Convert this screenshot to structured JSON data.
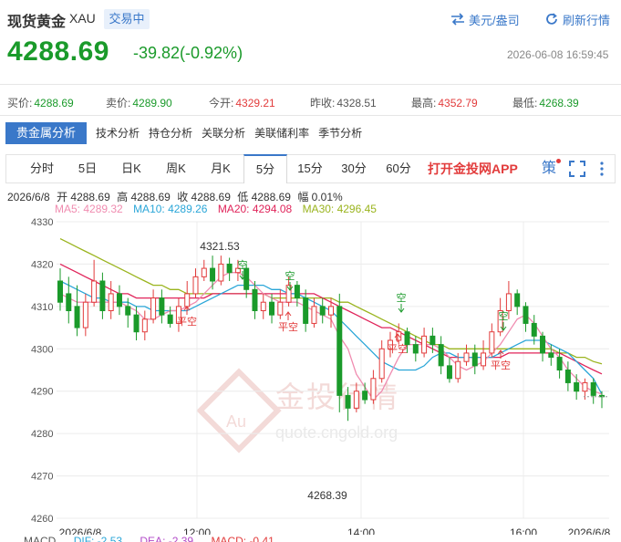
{
  "header": {
    "title": "现货黄金",
    "code": "XAU",
    "status": "交易中",
    "currency_label": "美元/盎司",
    "refresh_label": "刷新行情"
  },
  "price": {
    "last": "4288.69",
    "change": "-39.82(-0.92%)",
    "datetime": "2026-06-08 16:59:45"
  },
  "quotes": [
    {
      "label": "买价:",
      "value": "4288.69",
      "color": "green"
    },
    {
      "label": "卖价:",
      "value": "4289.90",
      "color": "green"
    },
    {
      "label": "今开:",
      "value": "4329.21",
      "color": "red"
    },
    {
      "label": "昨收:",
      "value": "4328.51",
      "color": "plain"
    },
    {
      "label": "最高:",
      "value": "4352.79",
      "color": "red"
    },
    {
      "label": "最低:",
      "value": "4268.39",
      "color": "green"
    }
  ],
  "tabs": [
    "贵金属分析",
    "技术分析",
    "持仓分析",
    "关联分析",
    "美联储利率",
    "季节分析"
  ],
  "periods": [
    "分时",
    "5日",
    "日K",
    "周K",
    "月K",
    "5分",
    "15分",
    "30分",
    "60分"
  ],
  "active_period": "5分",
  "toolbar": {
    "app_link": "打开金投网APP",
    "strategy": "策",
    "fullscreen_icon": "fullscreen-icon",
    "more_icon": "more-vertical-icon"
  },
  "bar_info": {
    "date": "2026/6/8",
    "open": "开 4288.69",
    "high": "高 4288.69",
    "close": "收 4288.69",
    "low": "低 4288.69",
    "amplitude": "幅 0.01%"
  },
  "ma_legend": [
    {
      "label": "MA5: 4289.32",
      "color": "#f08cb0"
    },
    {
      "label": "MA10: 4289.26",
      "color": "#2aa6d8"
    },
    {
      "label": "MA20: 4294.08",
      "color": "#e0245a"
    },
    {
      "label": "MA30: 4296.45",
      "color": "#9ab41e"
    }
  ],
  "macd_row": [
    {
      "label": "MACD",
      "color": "#555"
    },
    {
      "label": "DIF: -2.53",
      "color": "#2aa6d8"
    },
    {
      "label": "DEA: -2.39",
      "color": "#b24ac8"
    },
    {
      "label": "MACD: -0.41",
      "color": "#e23b3b"
    }
  ],
  "watermark": {
    "brand": "金投行情",
    "url": "quote.cngold.org",
    "logo": "Au"
  },
  "colors": {
    "up": "#e23b3b",
    "down": "#1a9a2a",
    "accent": "#3a78c9"
  },
  "chart_data": {
    "type": "candlestick",
    "ylim": [
      4260,
      4330
    ],
    "yticks": [
      4330,
      4320,
      4310,
      4300,
      4290,
      4280,
      4270,
      4260
    ],
    "xticks": [
      "2026/6/8",
      "12:00",
      "14:00",
      "16:00",
      "2026/6/8"
    ],
    "annotations": [
      {
        "text": "4321.53",
        "kind": "high"
      },
      {
        "text": "4268.39",
        "kind": "low"
      }
    ],
    "signals": [
      "平空",
      "空",
      "平空",
      "空",
      "平空",
      "空",
      "平空"
    ],
    "candles": [
      [
        4316,
        4311,
        4319,
        4309
      ],
      [
        4313,
        4309,
        4317,
        4306
      ],
      [
        4310,
        4305,
        4315,
        4303
      ],
      [
        4305,
        4311,
        4313,
        4303
      ],
      [
        4311,
        4316,
        4321,
        4310
      ],
      [
        4316,
        4309,
        4318,
        4307
      ],
      [
        4309,
        4313,
        4316,
        4307
      ],
      [
        4313,
        4310,
        4315,
        4308
      ],
      [
        4310,
        4308,
        4312,
        4305
      ],
      [
        4308,
        4304,
        4310,
        4302
      ],
      [
        4304,
        4307,
        4309,
        4302
      ],
      [
        4307,
        4312,
        4314,
        4306
      ],
      [
        4312,
        4308,
        4314,
        4306
      ],
      [
        4308,
        4306,
        4310,
        4305
      ],
      [
        4306,
        4310,
        4312,
        4304
      ],
      [
        4310,
        4313,
        4316,
        4309
      ],
      [
        4313,
        4317,
        4319,
        4312
      ],
      [
        4317,
        4319,
        4321,
        4316
      ],
      [
        4319,
        4316,
        4322,
        4314
      ],
      [
        4316,
        4320,
        4322,
        4315
      ],
      [
        4320,
        4318,
        4321.5,
        4316
      ],
      [
        4318,
        4319,
        4321,
        4316
      ],
      [
        4319,
        4314,
        4320,
        4312
      ],
      [
        4314,
        4309,
        4316,
        4307
      ],
      [
        4309,
        4311,
        4313,
        4307
      ],
      [
        4311,
        4308,
        4313,
        4306
      ],
      [
        4308,
        4311,
        4314,
        4307
      ],
      [
        4311,
        4315,
        4317,
        4310
      ],
      [
        4315,
        4312,
        4316,
        4310
      ],
      [
        4312,
        4306,
        4314,
        4304
      ],
      [
        4306,
        4310,
        4312,
        4305
      ],
      [
        4310,
        4308,
        4312,
        4306
      ],
      [
        4308,
        4310,
        4312,
        4305
      ],
      [
        4310,
        4289,
        4313,
        4285
      ],
      [
        4289,
        4286,
        4291,
        4283
      ],
      [
        4286,
        4290,
        4292,
        4285
      ],
      [
        4290,
        4288,
        4292,
        4287
      ],
      [
        4288,
        4293,
        4295,
        4287
      ],
      [
        4293,
        4300,
        4302,
        4292
      ],
      [
        4300,
        4302,
        4304,
        4298
      ],
      [
        4302,
        4304,
        4306,
        4301
      ],
      [
        4304,
        4301,
        4305,
        4299
      ],
      [
        4301,
        4299,
        4303,
        4297
      ],
      [
        4299,
        4303,
        4305,
        4298
      ],
      [
        4303,
        4301,
        4305,
        4299
      ],
      [
        4301,
        4296,
        4303,
        4294
      ],
      [
        4296,
        4293,
        4298,
        4292
      ],
      [
        4293,
        4297,
        4299,
        4292
      ],
      [
        4297,
        4299,
        4301,
        4296
      ],
      [
        4299,
        4296,
        4301,
        4294
      ],
      [
        4296,
        4299,
        4302,
        4295
      ],
      [
        4299,
        4304,
        4306,
        4298
      ],
      [
        4304,
        4309,
        4312,
        4303
      ],
      [
        4309,
        4313,
        4316,
        4307
      ],
      [
        4313,
        4310,
        4314,
        4308
      ],
      [
        4310,
        4306,
        4311,
        4304
      ],
      [
        4306,
        4303,
        4308,
        4301
      ],
      [
        4303,
        4299,
        4304,
        4297
      ],
      [
        4299,
        4298,
        4301,
        4296
      ],
      [
        4298,
        4295,
        4300,
        4293
      ],
      [
        4295,
        4292,
        4297,
        4290
      ],
      [
        4292,
        4290,
        4294,
        4288
      ],
      [
        4290,
        4292,
        4293,
        4288
      ],
      [
        4292,
        4289,
        4293,
        4287
      ],
      [
        4289,
        4288.69,
        4290,
        4286
      ]
    ],
    "candles_note": "open, close, high, low per 5-minute bar",
    "ma5": [
      4313,
      4312,
      4311,
      4311,
      4311,
      4311,
      4311,
      4311,
      4310,
      4309,
      4307,
      4307,
      4308,
      4309,
      4309,
      4310,
      4311,
      4313,
      4315,
      4317,
      4318,
      4318,
      4317,
      4315,
      4313,
      4312,
      4311,
      4311,
      4311,
      4310,
      4309,
      4308,
      4307,
      4303,
      4300,
      4294,
      4291,
      4288,
      4290,
      4294,
      4298,
      4301,
      4301,
      4301,
      4301,
      4300,
      4298,
      4296,
      4295,
      4296,
      4297,
      4299,
      4301,
      4304,
      4307,
      4308,
      4306,
      4303,
      4300,
      4298,
      4295,
      4293,
      4291,
      4290,
      4289.32
    ],
    "ma10": [
      4316,
      4315,
      4314,
      4313,
      4312,
      4312,
      4311,
      4311,
      4311,
      4310,
      4310,
      4309,
      4309,
      4309,
      4309,
      4309,
      4310,
      4311,
      4312,
      4313,
      4314,
      4315,
      4315,
      4315,
      4315,
      4314,
      4314,
      4313,
      4313,
      4312,
      4311,
      4310,
      4309,
      4307,
      4305,
      4303,
      4301,
      4299,
      4297,
      4296,
      4295,
      4295,
      4295,
      4296,
      4298,
      4299,
      4299,
      4298,
      4298,
      4298,
      4298,
      4298,
      4299,
      4300,
      4301,
      4302,
      4302,
      4302,
      4301,
      4300,
      4299,
      4297,
      4295,
      4293,
      4289.26
    ],
    "ma20": [
      4320,
      4319,
      4318,
      4317,
      4316,
      4315,
      4314,
      4313,
      4313,
      4312,
      4312,
      4312,
      4312,
      4312,
      4312,
      4312,
      4312,
      4312,
      4313,
      4313,
      4313,
      4313,
      4313,
      4313,
      4313,
      4313,
      4313,
      4313,
      4313,
      4313,
      4313,
      4312,
      4311,
      4310,
      4309,
      4308,
      4307,
      4306,
      4305,
      4305,
      4304,
      4303,
      4302,
      4301,
      4300,
      4299,
      4298,
      4298,
      4298,
      4298,
      4298,
      4298,
      4298,
      4299,
      4299,
      4299,
      4299,
      4299,
      4299,
      4299,
      4298,
      4297,
      4296,
      4295,
      4294.08
    ],
    "ma30": [
      4326,
      4325,
      4324,
      4323,
      4322,
      4321,
      4320,
      4319,
      4318,
      4317,
      4316,
      4315,
      4315,
      4314,
      4314,
      4313,
      4313,
      4313,
      4313,
      4313,
      4313,
      4313,
      4313,
      4313,
      4313,
      4312,
      4312,
      4312,
      4312,
      4312,
      4312,
      4312,
      4312,
      4311,
      4311,
      4310,
      4309,
      4308,
      4307,
      4306,
      4305,
      4304,
      4303,
      4302,
      4301,
      4301,
      4300,
      4300,
      4300,
      4300,
      4300,
      4300,
      4300,
      4300,
      4300,
      4300,
      4300,
      4300,
      4300,
      4299,
      4299,
      4298,
      4298,
      4297,
      4296.45
    ]
  }
}
